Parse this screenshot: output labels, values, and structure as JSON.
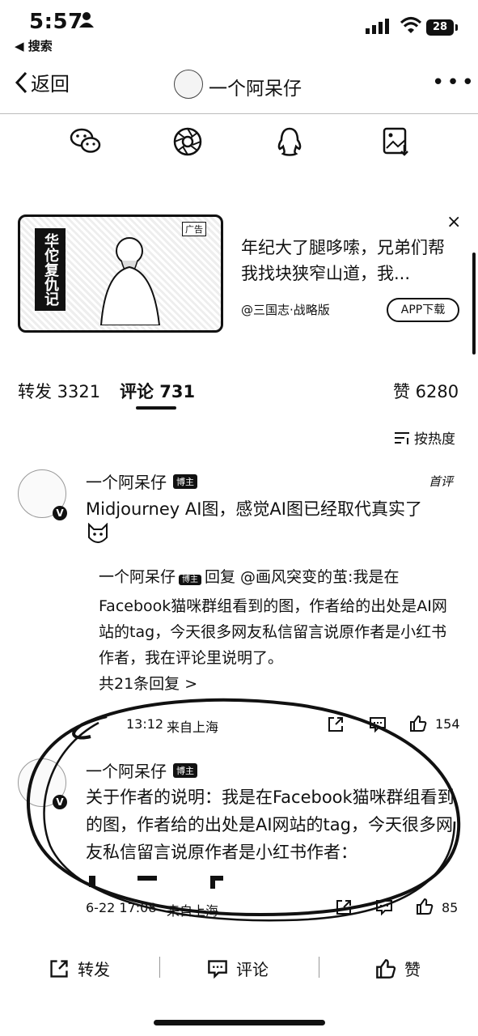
{
  "status": {
    "time": "5:57",
    "back_app": "◀ 搜索",
    "battery": "28"
  },
  "nav": {
    "back_label": "返回",
    "title": "一个阿呆仔"
  },
  "share_icons": [
    "wechat-icon",
    "moments-icon",
    "qq-icon",
    "save-image-icon"
  ],
  "ad": {
    "image_title": "华佗复仇记",
    "badge": "广告",
    "text": "年纪大了腿哆嗦，兄弟们帮我找块狭窄山道，我...",
    "source": "@三国志·战略版",
    "button": "APP下载",
    "close": "×"
  },
  "tabs": {
    "repost": "转发 3321",
    "comment": "评论 731",
    "like": "赞 6280",
    "sort": "按热度"
  },
  "comments": [
    {
      "name": "一个阿呆仔",
      "host_badge": "博主",
      "tag": "首评",
      "text": "Midjourney AI图，感觉AI图已经取代真实了",
      "reply": {
        "author": "一个阿呆仔",
        "badge": "博主",
        "text": "回复 @画风突变的茧:我是在Facebook猫咪群组看到的图，作者给的出处是AI网站的tag，今天很多网友私信留言说原作者是小红书作者，我在评论里说明了。",
        "more": "共21条回复 >"
      },
      "meta": {
        "time": "13:12",
        "location": "来自上海",
        "likes": "154"
      }
    },
    {
      "name": "一个阿呆仔",
      "host_badge": "博主",
      "text": "关于作者的说明：我是在Facebook猫咪群组看到的图，作者给的出处是AI网站的tag，今天很多网友私信留言说原作者是小红书作者：",
      "meta": {
        "time": "6-22 17:08",
        "location": "来自上海",
        "likes": "85"
      }
    }
  ],
  "bottom": {
    "repost": "转发",
    "comment": "评论",
    "like": "赞"
  }
}
